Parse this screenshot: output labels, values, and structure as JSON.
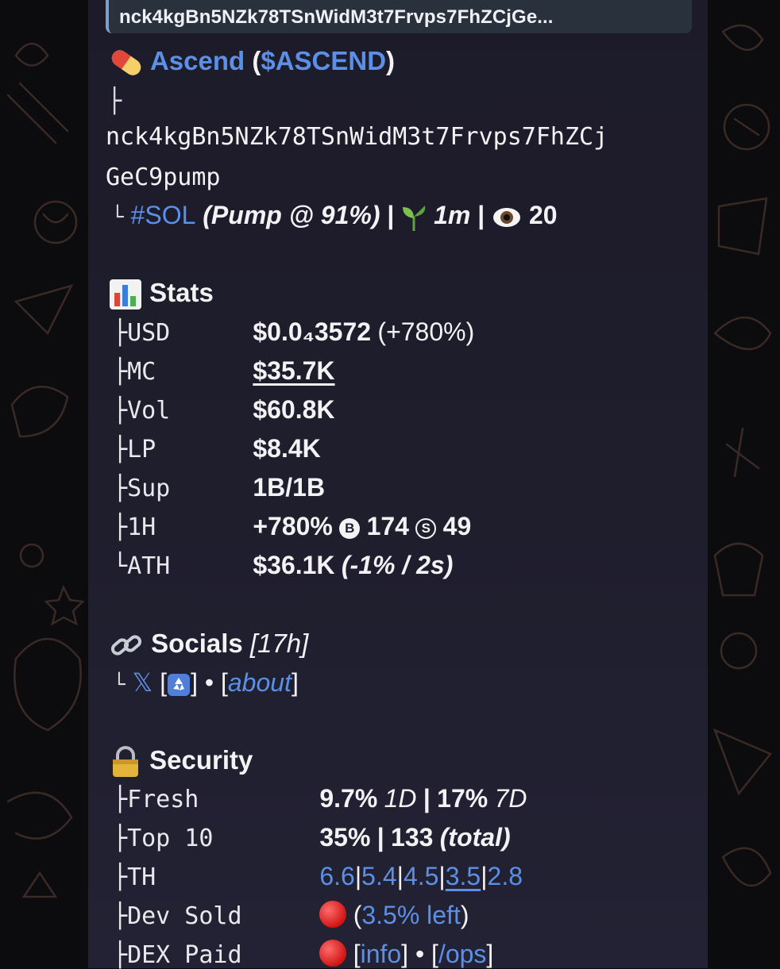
{
  "reply_preview": "nck4kgBn5NZk78TSnWidM3t7Frvps7FhZCjGe...",
  "token": {
    "pill_icon": "pill-icon",
    "name": "Ascend",
    "ticker": "$ASCEND",
    "tree_branch": "├",
    "address_line1": "nck4kgBn5NZk78TSnWidM3t7Frvps7FhZCj",
    "address_line2": "GeC9pump",
    "tree_end": "└",
    "chain_tag": "#SOL",
    "pump_text": "(Pump @ ",
    "pump_pct": "91%",
    "pump_close": ")",
    "sep": "|",
    "age": "1m",
    "views": "20",
    "sprout_icon": "seedling-icon",
    "eye_icon": "eye-icon"
  },
  "stats": {
    "heading": "Stats",
    "icon": "bar-chart-icon",
    "rows": [
      {
        "tree": "├",
        "label": "USD",
        "value": "$0.0₄3572",
        "extra": "(+780%)"
      },
      {
        "tree": "├",
        "label": "MC",
        "value": "$35.7K"
      },
      {
        "tree": "├",
        "label": "Vol",
        "value": "$60.8K"
      },
      {
        "tree": "├",
        "label": "LP",
        "value": "$8.4K"
      },
      {
        "tree": "├",
        "label": "Sup",
        "value": "1B/1B"
      },
      {
        "tree": "├",
        "label": "1H",
        "value": "+780%",
        "buys": "174",
        "sells": "49",
        "buy_glyph": "B",
        "sell_glyph": "S"
      },
      {
        "tree": "└",
        "label": "ATH",
        "value": "$36.1K",
        "extra": "(-1% / 2s)"
      }
    ]
  },
  "socials": {
    "heading": "Socials",
    "age": "[17h]",
    "icon": "link-icon",
    "tree": "└",
    "x_glyph": "𝕏",
    "recycle_bracket_open": "[",
    "recycle_bracket_close": "]",
    "dot": "•",
    "about_open": "[",
    "about": "about",
    "about_close": "]"
  },
  "security": {
    "heading": "Security",
    "icon": "lock-icon",
    "rows": [
      {
        "tree": "├",
        "label": "Fresh",
        "v1": "9.7%",
        "i1": "1D",
        "sep": "|",
        "v2": "17%",
        "i2": "7D"
      },
      {
        "tree": "├",
        "label": "Top 10",
        "v1": "35%",
        "sep": "|",
        "v2": "133",
        "i2": "(total)"
      },
      {
        "tree": "├",
        "label": "TH",
        "holders": [
          "6.6",
          "5.4",
          "4.5",
          "3.5",
          "2.8"
        ],
        "bar": "|"
      },
      {
        "tree": "├",
        "label": "Dev Sold",
        "paren_open": "(",
        "left": "3.5% left",
        "paren_close": ")"
      },
      {
        "tree": "├",
        "label": "DEX Paid",
        "info": "info",
        "ops": "/ops",
        "sep": "•"
      }
    ]
  },
  "colors": {
    "link": "#5c8fe6",
    "bubble": "#1f1e2d",
    "reply_bar": "#7f9fc6"
  }
}
